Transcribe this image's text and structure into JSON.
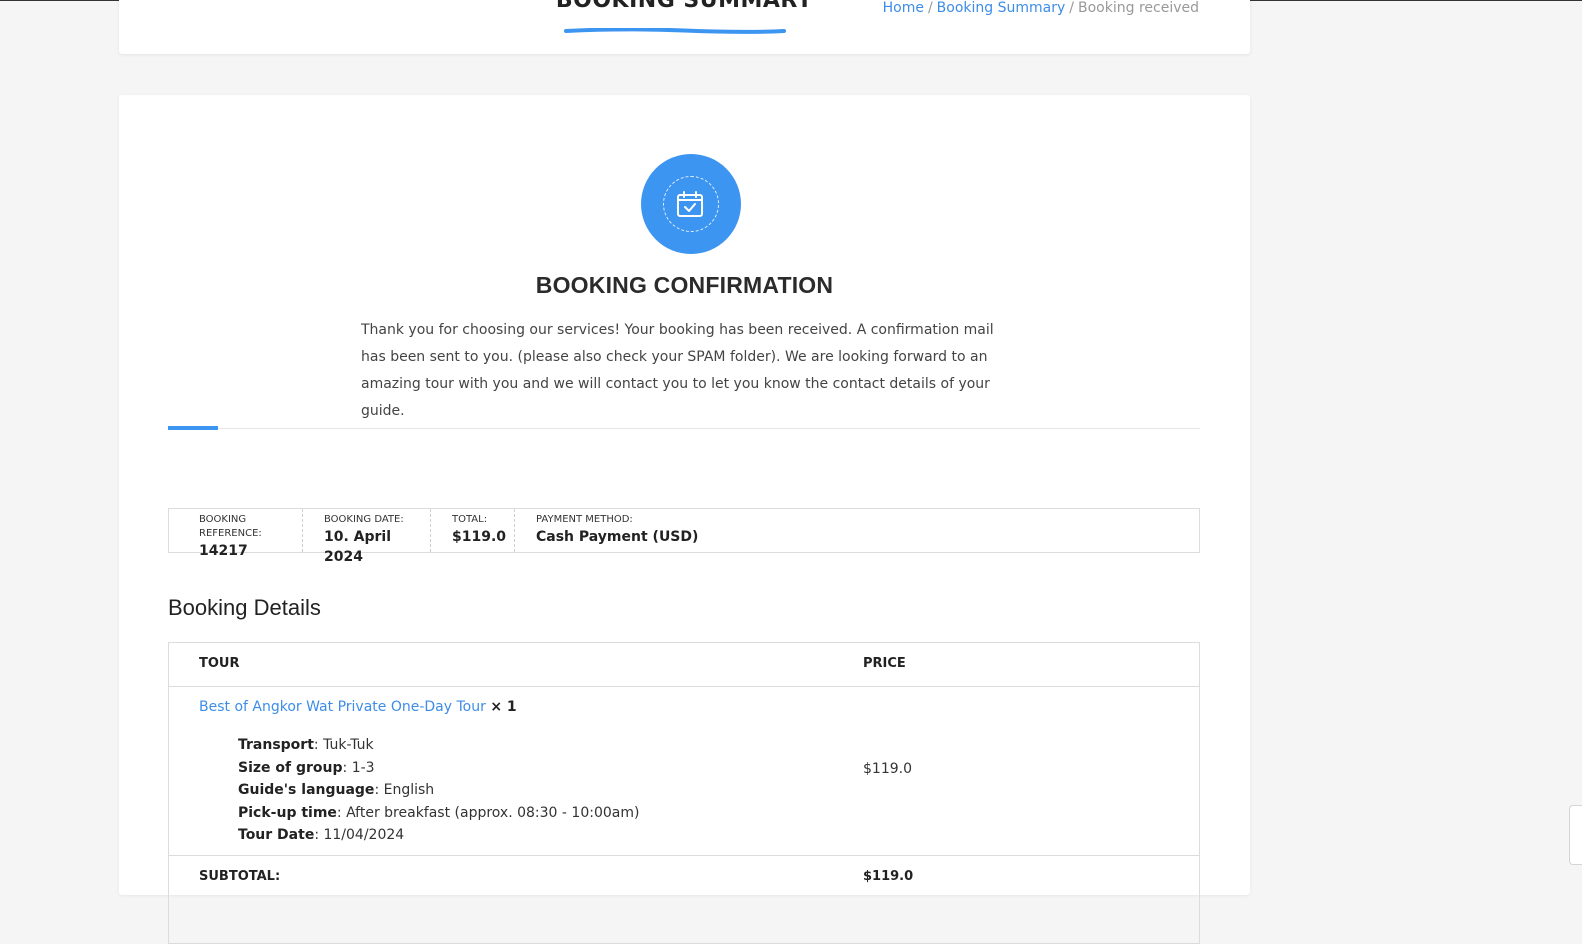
{
  "header": {
    "title": "BOOKING SUMMARY",
    "breadcrumb": {
      "home": "Home",
      "summary": "Booking Summary",
      "current": "Booking received",
      "separator": "/"
    }
  },
  "confirmation": {
    "icon": "calendar-check-icon",
    "heading": "BOOKING CONFIRMATION",
    "message": "Thank you for choosing our services! Your booking has been received. A confirmation mail has been sent to you. (please also check your SPAM folder). We are looking forward to an amazing tour with you and we will contact you to let you know the contact details of your guide."
  },
  "summary": {
    "reference_label": "BOOKING REFERENCE:",
    "reference": "14217",
    "date_label": "BOOKING DATE:",
    "date": "10. April 2024",
    "total_label": "TOTAL:",
    "total": "$119.0",
    "payment_label": "PAYMENT METHOD:",
    "payment": "Cash Payment (USD)"
  },
  "details": {
    "heading": "Booking Details",
    "col_tour": "TOUR",
    "col_price": "PRICE",
    "item": {
      "name": "Best of Angkor Wat Private One-Day Tour",
      "qty": "× 1",
      "price": "$119.0",
      "meta": [
        {
          "label": "Transport",
          "value": "Tuk-Tuk"
        },
        {
          "label": "Size of group",
          "value": "1-3"
        },
        {
          "label": "Guide's language",
          "value": "English"
        },
        {
          "label": "Pick-up time",
          "value": "After breakfast (approx. 08:30 - 10:00am)"
        },
        {
          "label": "Tour Date",
          "value": "11/04/2024"
        }
      ]
    },
    "subtotal_label": "SUBTOTAL:",
    "subtotal": "$119.0"
  },
  "colors": {
    "accent": "#3d95f2",
    "link": "#3d8de8"
  }
}
